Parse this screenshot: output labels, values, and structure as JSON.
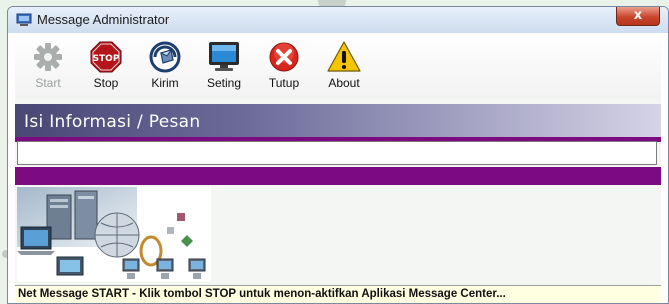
{
  "window": {
    "title": "Message Administrator",
    "close_label": "x"
  },
  "toolbar": {
    "items": [
      {
        "label": "Start",
        "icon": "gear-icon",
        "enabled": false
      },
      {
        "label": "Stop",
        "icon": "stop-sign-icon",
        "enabled": true
      },
      {
        "label": "Kirim",
        "icon": "send-icon",
        "enabled": true
      },
      {
        "label": "Seting",
        "icon": "monitor-icon",
        "enabled": true
      },
      {
        "label": "Tutup",
        "icon": "close-circle-icon",
        "enabled": true
      },
      {
        "label": "About",
        "icon": "warning-icon",
        "enabled": true
      }
    ],
    "stop_icon_text": "STOP"
  },
  "section": {
    "title": "Isi Informasi / Pesan"
  },
  "message": {
    "value": "",
    "placeholder": ""
  },
  "status": {
    "text": "Net Message START - Klik tombol STOP untuk menon-aktifkan Aplikasi Message Center..."
  },
  "colors": {
    "accent_purple": "#7c0a80",
    "header_band": "#4a4775",
    "status_bg": "#ffffe1",
    "close_red": "#c9462c"
  }
}
